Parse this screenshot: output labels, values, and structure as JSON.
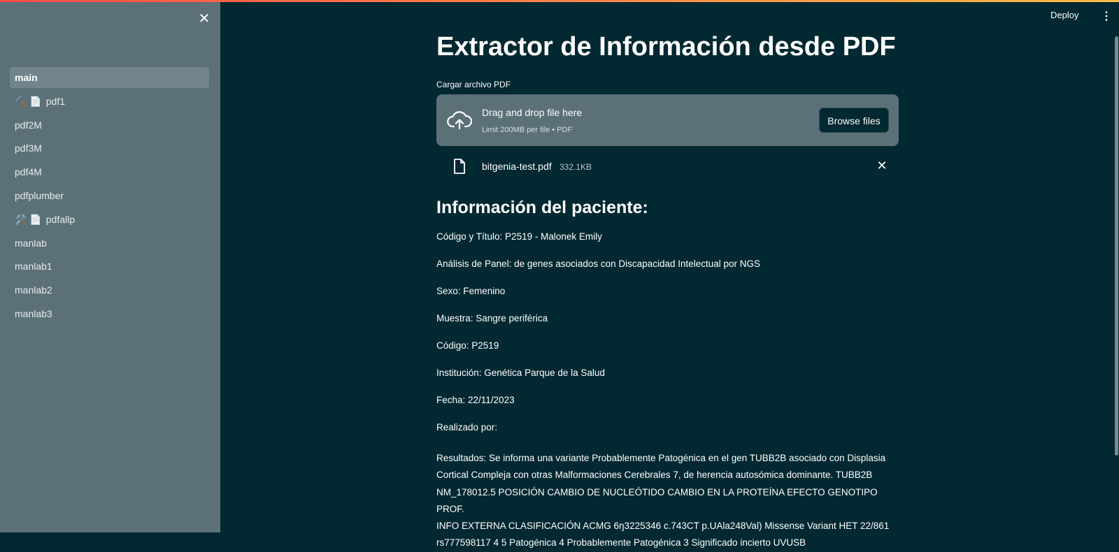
{
  "header": {
    "deploy_label": "Deploy",
    "menu_icon": "⋮"
  },
  "sidebar": {
    "close_icon": "✕",
    "items": [
      {
        "label": "main",
        "icon": "",
        "active": true
      },
      {
        "label": "pdf1",
        "icon": "⛏️ 📄",
        "active": false
      },
      {
        "label": "pdf2M",
        "icon": "",
        "active": false
      },
      {
        "label": "pdf3M",
        "icon": "",
        "active": false
      },
      {
        "label": "pdf4M",
        "icon": "",
        "active": false
      },
      {
        "label": "pdfplumber",
        "icon": "",
        "active": false
      },
      {
        "label": "pdfallp",
        "icon": "🛠️ 📄",
        "active": false
      },
      {
        "label": "manlab",
        "icon": "",
        "active": false
      },
      {
        "label": "manlab1",
        "icon": "",
        "active": false
      },
      {
        "label": "manlab2",
        "icon": "",
        "active": false
      },
      {
        "label": "manlab3",
        "icon": "",
        "active": false
      }
    ]
  },
  "main": {
    "title": "Extractor de Información desde PDF",
    "uploader": {
      "label": "Cargar archivo PDF",
      "drag_text": "Drag and drop file here",
      "limit_text": "Limit 200MB per file • PDF",
      "browse_label": "Browse files"
    },
    "file": {
      "name": "bitgenia-test.pdf",
      "size": "332.1KB",
      "remove_icon": "✕"
    },
    "section_title": "Información del paciente:",
    "info": [
      "Código y Título: P2519 - Malonek Emily",
      "Análisis de Panel: de genes asociados con Discapacidad Intelectual por NGS",
      "Sexo: Femenino",
      "Muestra: Sangre periférica",
      "Código: P2519",
      "Institución: Genética Parque de la Salud",
      "Fecha: 22/11/2023",
      "Realizado por:"
    ],
    "results": [
      "Resultados: Se informa una variante Probablemente Patogénica en el gen TUBB2B asociado con Displasia",
      "Cortical Compleja con otras Malformaciones Cerebrales 7, de herencia autosómica dominante. TUBB2B",
      "NM_178012.5 POSICIÓN CAMBIO DE NUCLEÓTIDO CAMBIO EN LA PROTEÍNA EFECTO GENOTIPO PROF.",
      "INFO EXTERNA CLASIFICACIÓN ACMG 6ŋ3225346 c.743CT p.UAla248Val) Missense Variant HET 22/861",
      "rs777598117 4 5 Patogénica 4 Probablemente Patogénica 3 Significado incierto UVUSB"
    ]
  },
  "colors": {
    "background": "#022831",
    "sidebar": "#5c7078",
    "dropzone": "#5c7078",
    "accent_gradient": [
      "#ff4b4b",
      "#ffbd45"
    ]
  }
}
